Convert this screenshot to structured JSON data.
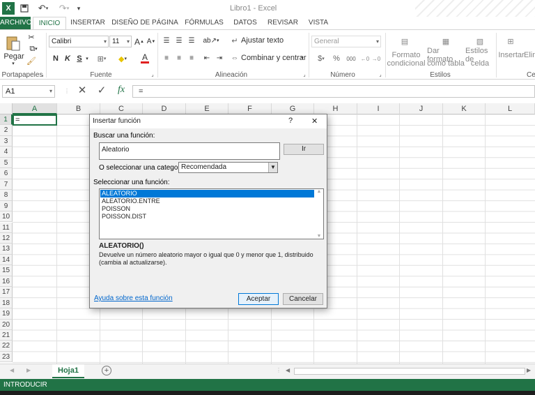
{
  "window": {
    "title": "Libro1 - Excel"
  },
  "ribbon_tabs": [
    "ARCHIVO",
    "INICIO",
    "INSERTAR",
    "DISEÑO DE PÁGINA",
    "FÓRMULAS",
    "DATOS",
    "REVISAR",
    "VISTA"
  ],
  "clipboard": {
    "paste_label": "Pegar",
    "group": "Portapapeles"
  },
  "font": {
    "name": "Calibri",
    "size": "11",
    "bold": "N",
    "italic": "K",
    "underline": "S",
    "group": "Fuente"
  },
  "alignment": {
    "wrap": "Ajustar texto",
    "merge": "Combinar y centrar",
    "group": "Alineación"
  },
  "number": {
    "format": "General",
    "currency": "$",
    "percent": "%",
    "thousands": "000",
    "group": "Número"
  },
  "styles": {
    "conditional_1": "Formato",
    "conditional_2": "condicional",
    "table_1": "Dar formato",
    "table_2": "como tabla",
    "cell_1": "Estilos de",
    "cell_2": "celda",
    "group": "Estilos"
  },
  "cells": {
    "insert": "Insertar",
    "delete": "Elim",
    "group": "Ce"
  },
  "formula_bar": {
    "name_box": "A1",
    "content": "=",
    "fx": "fx"
  },
  "columns": [
    "A",
    "B",
    "C",
    "D",
    "E",
    "F",
    "G",
    "H",
    "I",
    "J",
    "K",
    "L"
  ],
  "rows": [
    "1",
    "2",
    "3",
    "4",
    "5",
    "6",
    "7",
    "8",
    "9",
    "10",
    "11",
    "12",
    "13",
    "14",
    "15",
    "16",
    "17",
    "18",
    "19",
    "20",
    "21",
    "22",
    "23"
  ],
  "cell_a1": "=",
  "sheet": {
    "tab": "Hoja1"
  },
  "status": "INTRODUCIR",
  "dialog": {
    "title": "Insertar función",
    "help_glyph": "?",
    "close_glyph": "✕",
    "search_label": "Buscar una función:",
    "search_value": "Aleatorio",
    "go_button": "Ir",
    "category_label": "O seleccionar una categoría:",
    "category_value": "Recomendada",
    "select_label": "Seleccionar una función:",
    "functions": [
      "ALEATORIO",
      "ALEATORIO.ENTRE",
      "POISSON",
      "POISSON.DIST"
    ],
    "selected_signature": "ALEATORIO()",
    "description": "Devuelve un número aleatorio mayor o igual que 0 y menor que 1, distribuido (cambia al actualizarse).",
    "help_link": "Ayuda sobre esta función",
    "ok": "Aceptar",
    "cancel": "Cancelar"
  },
  "accent_color": "#217346",
  "selection_color": "#0078d7"
}
